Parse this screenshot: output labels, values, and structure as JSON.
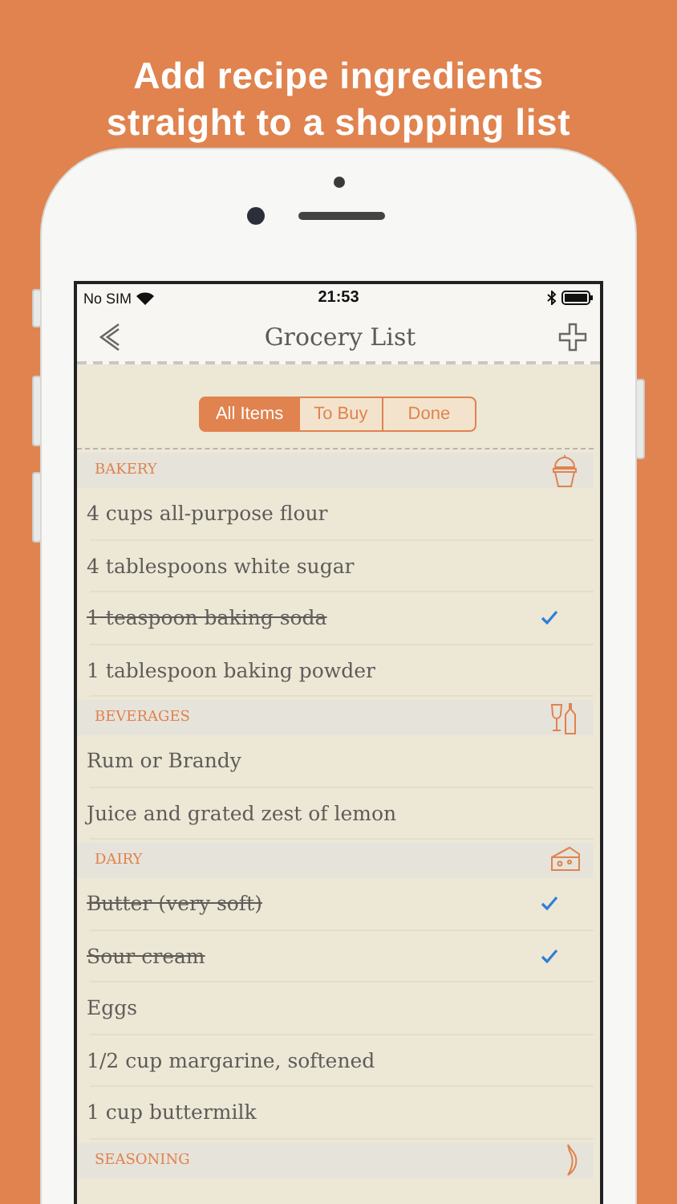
{
  "headline": "Add recipe ingredients straight to a shopping list",
  "status_bar": {
    "carrier": "No SIM",
    "time": "21:53"
  },
  "nav": {
    "title": "Grocery List"
  },
  "tabs": [
    {
      "label": "All Items",
      "selected": true
    },
    {
      "label": "To Buy",
      "selected": false
    },
    {
      "label": "Done",
      "selected": false
    }
  ],
  "sections": [
    {
      "title": "BAKERY",
      "kind": "cupcake",
      "items": [
        {
          "text": "4 cups all-purpose flour",
          "checked": false
        },
        {
          "text": "4 tablespoons white sugar",
          "checked": false
        },
        {
          "text": "1 teaspoon baking soda",
          "checked": true
        },
        {
          "text": "1 tablespoon baking powder",
          "checked": false
        }
      ]
    },
    {
      "title": "BEVERAGES",
      "kind": "drinks",
      "items": [
        {
          "text": "Rum or Brandy",
          "checked": false
        },
        {
          "text": "Juice and grated zest of lemon",
          "checked": false
        }
      ]
    },
    {
      "title": "DAIRY",
      "kind": "cheese",
      "items": [
        {
          "text": "Butter (very soft)",
          "checked": true
        },
        {
          "text": "Sour cream",
          "checked": true
        },
        {
          "text": "Eggs",
          "checked": false
        },
        {
          "text": "1/2 cup margarine, softened",
          "checked": false
        },
        {
          "text": "1 cup buttermilk",
          "checked": false
        }
      ]
    },
    {
      "title": "SEASONING",
      "kind": "pepper"
    }
  ]
}
